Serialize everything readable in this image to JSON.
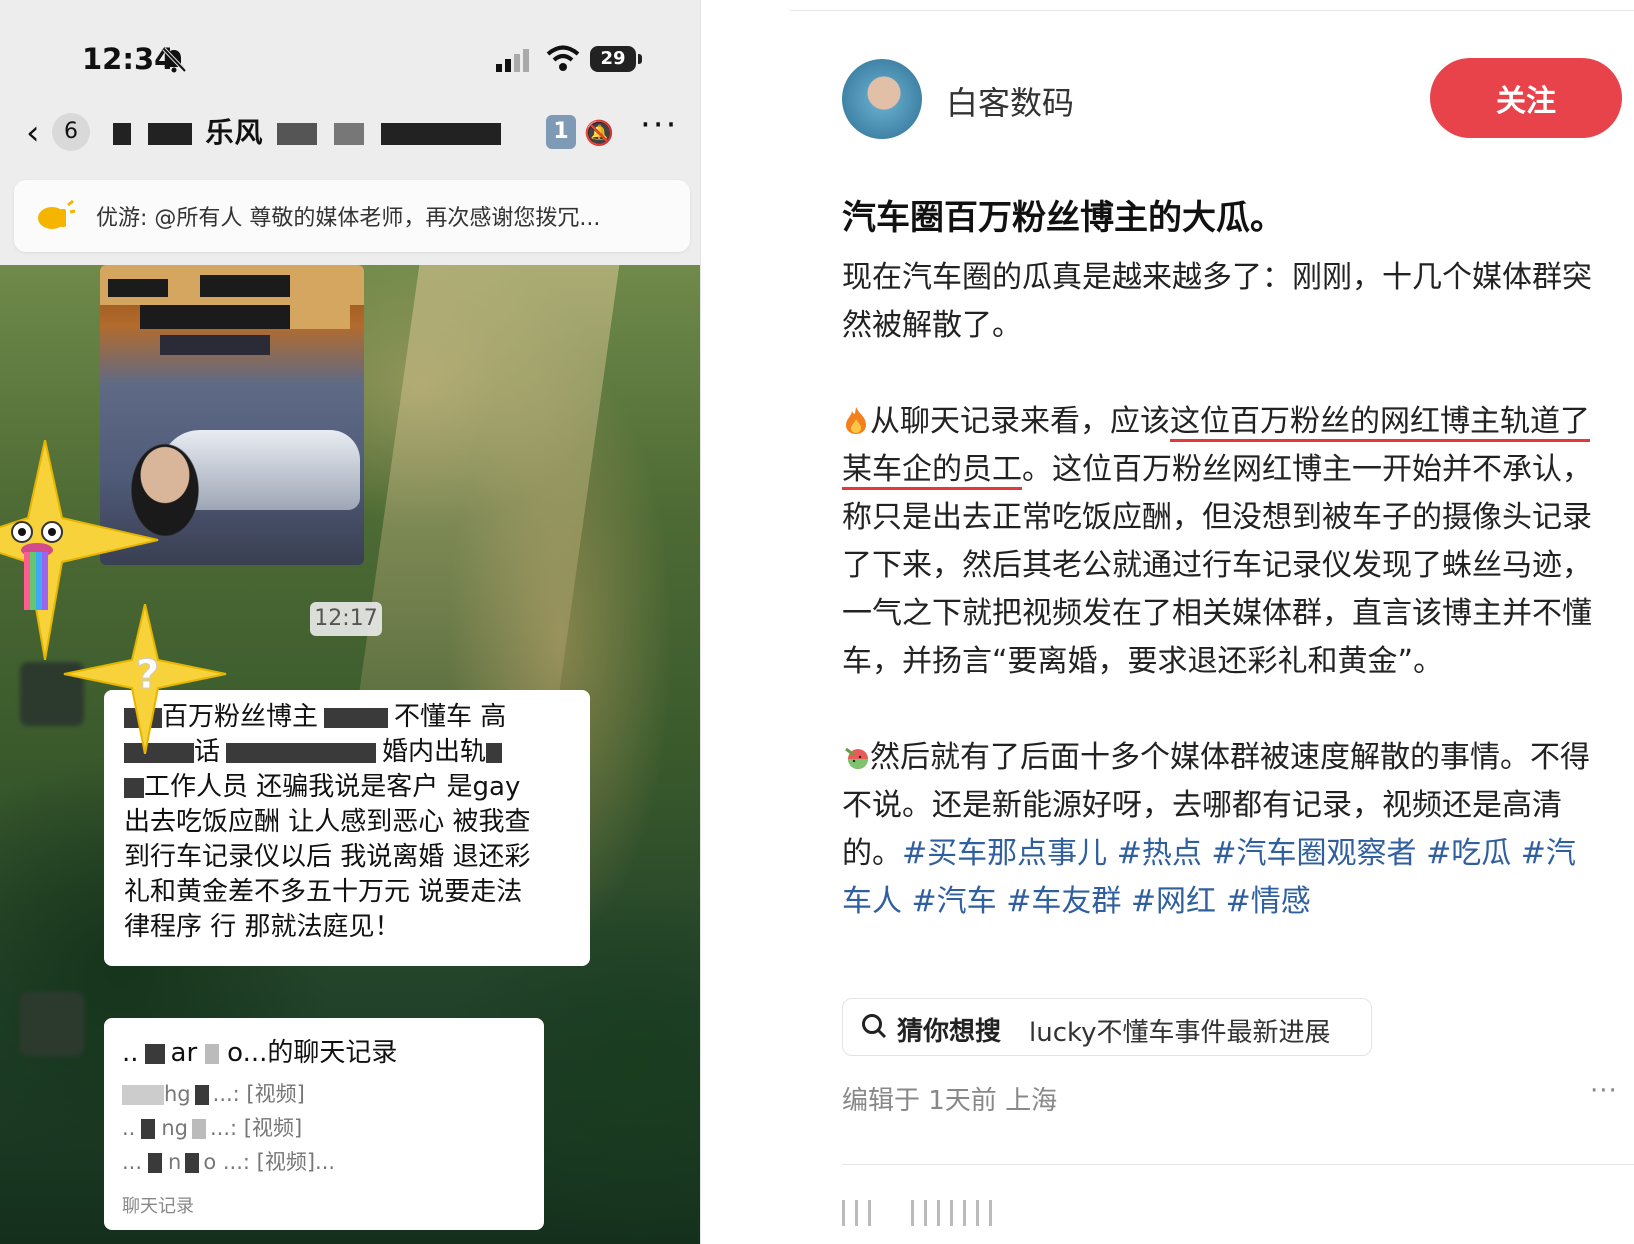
{
  "phone": {
    "status_time": "12:34",
    "battery": "29",
    "unread_count": "6",
    "group_title_visible": "乐风",
    "member_badge": "1",
    "pinned": {
      "text": "优游: @所有人  尊敬的媒体老师，再次感谢您拨冗..."
    },
    "time_separator": "12:17",
    "message": {
      "line1": "百万粉丝博主",
      "line1b": "不懂车 高",
      "line2": "话",
      "line2b": "婚内出轨",
      "line3": "工作人员 还骗我说是客户 是gay",
      "line4": "出去吃饭应酬 让人感到恶心 被我查",
      "line5": "到行车记录仪以后 我说离婚 退还彩",
      "line6": "礼和黄金差不多五十万元 说要走法",
      "line7": "律程序 行 那就法庭见！"
    },
    "chat_record": {
      "title_prefix": "..",
      "title_mid": "ar",
      "title_suffix": "o...的聊天记录",
      "lines": [
        {
          "prefix": "",
          "mid": "hg",
          "suffix": "...: [视频]"
        },
        {
          "prefix": "..",
          "mid": "ng",
          "suffix": "...: [视频]"
        },
        {
          "prefix": "...",
          "mid": "n",
          "suffix": "o ...: [视频]..."
        }
      ],
      "footer": "聊天记录"
    }
  },
  "article": {
    "author": "白客数码",
    "follow_label": "关注",
    "title": "汽车圈百万粉丝博主的大瓜。",
    "p1": "现在汽车圈的瓜真是越来越多了：刚刚，十几个媒体群突然被解散了。",
    "p2_a": "从聊天记录来看，应该",
    "p2_ul": "这位百万粉丝的网红博主轨道了某车企的员工",
    "p2_b": "。这位百万粉丝网红博主一开始并不承认，称只是出去正常吃饭应酬，但没想到被车子的摄像头记录了下来，然后其老公就通过行车记录仪发现了蛛丝马迹，一气之下就把视频发在了相关媒体群，直言该博主并不懂车，并扬言“要离婚，要求退还彩礼和黄金”。",
    "p3": "然后就有了后面十多个媒体群被速度解散的事情。不得不说。还是新能源好呀，去哪都有记录，视频还是高清的。",
    "tags": [
      "#买车那点事儿",
      "#热点",
      "#汽车圈观察者",
      "#吃瓜",
      "#汽车人",
      "#汽车",
      "#车友群",
      "#网红",
      "#情感"
    ],
    "search": {
      "label": "猜你想搜",
      "query": "lucky不懂车事件最新进展"
    },
    "edit_meta": "编辑于 1天前 上海",
    "more": "···",
    "colors": {
      "follow": "#e8424b",
      "tag": "#2f5f9e",
      "underline": "#e23a3a"
    }
  }
}
